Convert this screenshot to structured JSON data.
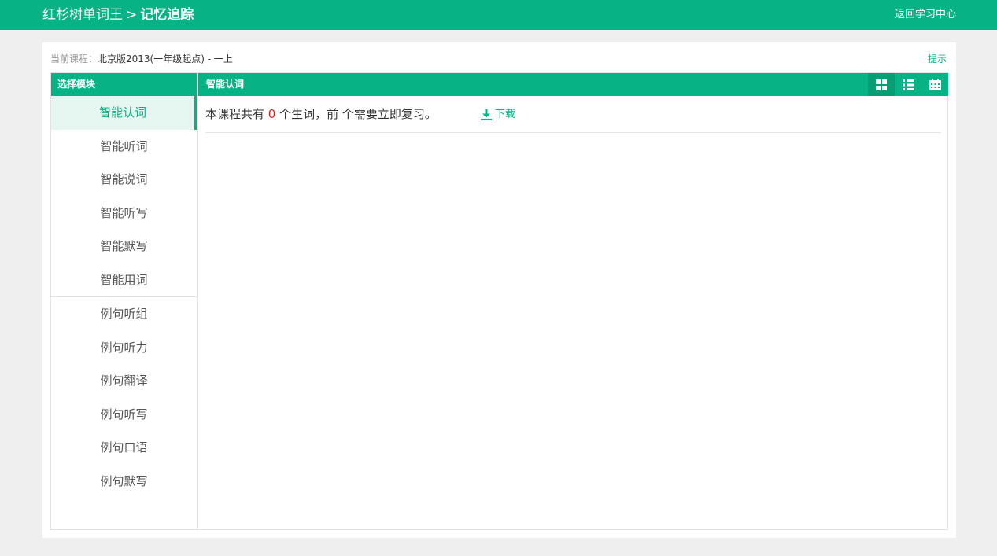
{
  "header": {
    "app_name": "红杉树单词王",
    "separator": ">",
    "current_page": "记忆追踪",
    "back_link": "返回学习中心"
  },
  "course": {
    "label": "当前课程：",
    "name": "北京版2013(一年级起点) - 一上",
    "hint": "提示"
  },
  "sidebar": {
    "title": "选择模块",
    "group1": [
      "智能认词",
      "智能听词",
      "智能说词",
      "智能听写",
      "智能默写",
      "智能用词"
    ],
    "group2": [
      "例句听组",
      "例句听力",
      "例句翻译",
      "例句听写",
      "例句口语",
      "例句默写"
    ],
    "active": "智能认词"
  },
  "main": {
    "title": "智能认词",
    "view_icons": [
      "grid-view-icon",
      "list-view-icon",
      "calendar-view-icon"
    ],
    "summary_pre": "本课程共有 ",
    "count": "0",
    "summary_post": " 个生词，前 个需要立即复习。",
    "download": "下载"
  },
  "colors": {
    "brand_green": "#07b384",
    "count_red": "#e02020"
  }
}
